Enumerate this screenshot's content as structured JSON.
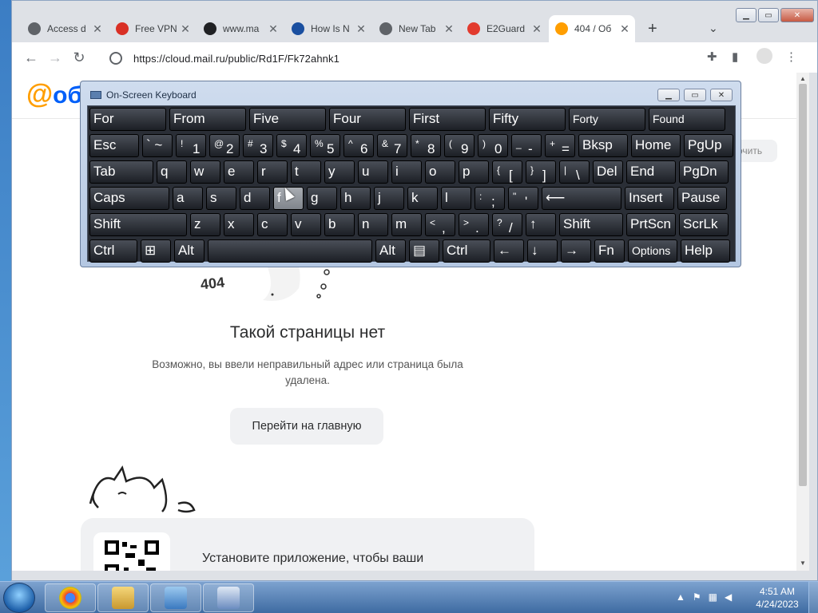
{
  "browser": {
    "tabs": [
      {
        "title": "Access d",
        "icon": "globe-icon",
        "color": "#5f6368"
      },
      {
        "title": "Free VPN",
        "icon": "vpn-icon",
        "color": "#d93025"
      },
      {
        "title": "www.ma",
        "icon": "yandex-browser-icon",
        "color": "#202124"
      },
      {
        "title": "How Is N",
        "icon": "sail-icon",
        "color": "#1a4fa0"
      },
      {
        "title": "New Tab",
        "icon": "chrome-icon",
        "color": "#5f6368"
      },
      {
        "title": "E2Guard",
        "icon": "yandex-icon",
        "color": "#e23b2e"
      },
      {
        "title": "404 / Об",
        "icon": "cloud-icon",
        "color": "#ff9e00"
      }
    ],
    "url": "https://cloud.mail.ru/public/Rd1F/Fk72ahnk1"
  },
  "page": {
    "logo_text": "@",
    "logo_suffix": "об",
    "header_button": "очить",
    "error_code": "404",
    "title": "Такой страницы нет",
    "description": "Возможно, вы ввели неправильный адрес или страница была удалена.",
    "home_button": "Перейти на главную",
    "promo_text": "Установите приложение, чтобы ваши"
  },
  "osk": {
    "title": "On-Screen Keyboard",
    "rows": [
      [
        {
          "label": "For",
          "w": 98
        },
        {
          "label": "From",
          "w": 98
        },
        {
          "label": "Five",
          "w": 98
        },
        {
          "label": "Four",
          "w": 98
        },
        {
          "label": "First",
          "w": 98
        },
        {
          "label": "Fifty",
          "w": 98
        },
        {
          "label": "Forty",
          "w": 98,
          "small": true
        },
        {
          "label": "Found",
          "w": 98,
          "small": true
        }
      ],
      [
        {
          "label": "Esc",
          "w": 64
        },
        {
          "label": "` ~",
          "w": 40
        },
        {
          "shift": "!",
          "label": "1",
          "w": 40
        },
        {
          "shift": "@",
          "label": "2",
          "w": 40
        },
        {
          "shift": "#",
          "label": "3",
          "w": 40
        },
        {
          "shift": "$",
          "label": "4",
          "w": 40
        },
        {
          "shift": "%",
          "label": "5",
          "w": 40
        },
        {
          "shift": "^",
          "label": "6",
          "w": 40
        },
        {
          "shift": "&",
          "label": "7",
          "w": 40
        },
        {
          "shift": "*",
          "label": "8",
          "w": 40
        },
        {
          "shift": "(",
          "label": "9",
          "w": 40
        },
        {
          "shift": ")",
          "label": "0",
          "w": 40
        },
        {
          "shift": "_",
          "label": "-",
          "w": 40
        },
        {
          "shift": "+",
          "label": "=",
          "w": 40
        },
        {
          "label": "Bksp",
          "w": 64
        },
        {
          "label": "Home",
          "w": 64
        },
        {
          "label": "PgUp",
          "w": 64
        }
      ],
      [
        {
          "label": "Tab",
          "w": 82
        },
        {
          "label": "q",
          "w": 40
        },
        {
          "label": "w",
          "w": 40
        },
        {
          "label": "e",
          "w": 40
        },
        {
          "label": "r",
          "w": 40
        },
        {
          "label": "t",
          "w": 40
        },
        {
          "label": "y",
          "w": 40
        },
        {
          "label": "u",
          "w": 40
        },
        {
          "label": "i",
          "w": 40
        },
        {
          "label": "o",
          "w": 40
        },
        {
          "label": "p",
          "w": 40
        },
        {
          "shift": "{",
          "label": "[",
          "w": 40
        },
        {
          "shift": "}",
          "label": "]",
          "w": 40
        },
        {
          "shift": "|",
          "label": "\\",
          "w": 40
        },
        {
          "label": "Del",
          "w": 40
        },
        {
          "label": "End",
          "w": 64
        },
        {
          "label": "PgDn",
          "w": 64
        }
      ],
      [
        {
          "label": "Caps",
          "w": 102
        },
        {
          "label": "a",
          "w": 40
        },
        {
          "label": "s",
          "w": 40
        },
        {
          "label": "d",
          "w": 40
        },
        {
          "label": "f",
          "w": 40,
          "hover": true
        },
        {
          "label": "g",
          "w": 40
        },
        {
          "label": "h",
          "w": 40
        },
        {
          "label": "j",
          "w": 40
        },
        {
          "label": "k",
          "w": 40
        },
        {
          "label": "l",
          "w": 40
        },
        {
          "shift": ":",
          "label": ";",
          "w": 40
        },
        {
          "shift": "\"",
          "label": "'",
          "w": 40
        },
        {
          "label": "⟵",
          "w": 102
        },
        {
          "label": "Insert",
          "w": 64
        },
        {
          "label": "Pause",
          "w": 64
        }
      ],
      [
        {
          "label": "Shift",
          "w": 124
        },
        {
          "label": "z",
          "w": 40
        },
        {
          "label": "x",
          "w": 40
        },
        {
          "label": "c",
          "w": 40
        },
        {
          "label": "v",
          "w": 40
        },
        {
          "label": "b",
          "w": 40
        },
        {
          "label": "n",
          "w": 40
        },
        {
          "label": "m",
          "w": 40
        },
        {
          "shift": "<",
          "label": ",",
          "w": 40
        },
        {
          "shift": ">",
          "label": ".",
          "w": 40
        },
        {
          "shift": "?",
          "label": "/",
          "w": 40
        },
        {
          "label": "↑",
          "w": 40
        },
        {
          "label": "Shift",
          "w": 82
        },
        {
          "label": "PrtScn",
          "w": 64
        },
        {
          "label": "ScrLk",
          "w": 64
        }
      ],
      [
        {
          "label": "Ctrl",
          "w": 62
        },
        {
          "label": "⊞",
          "w": 40
        },
        {
          "label": "Alt",
          "w": 40
        },
        {
          "label": "",
          "w": 208
        },
        {
          "label": "Alt",
          "w": 40
        },
        {
          "label": "▤",
          "w": 40
        },
        {
          "label": "Ctrl",
          "w": 62
        },
        {
          "label": "←",
          "w": 40
        },
        {
          "label": "↓",
          "w": 40
        },
        {
          "label": "→",
          "w": 40
        },
        {
          "label": "Fn",
          "w": 40
        },
        {
          "label": "Options",
          "w": 64,
          "small": true
        },
        {
          "label": "Help",
          "w": 64
        }
      ]
    ]
  },
  "taskbar": {
    "apps": [
      "chrome-icon",
      "explorer-icon",
      "control-panel-icon",
      "keyboard-icon"
    ],
    "time": "4:51 AM",
    "date": "4/24/2023"
  }
}
